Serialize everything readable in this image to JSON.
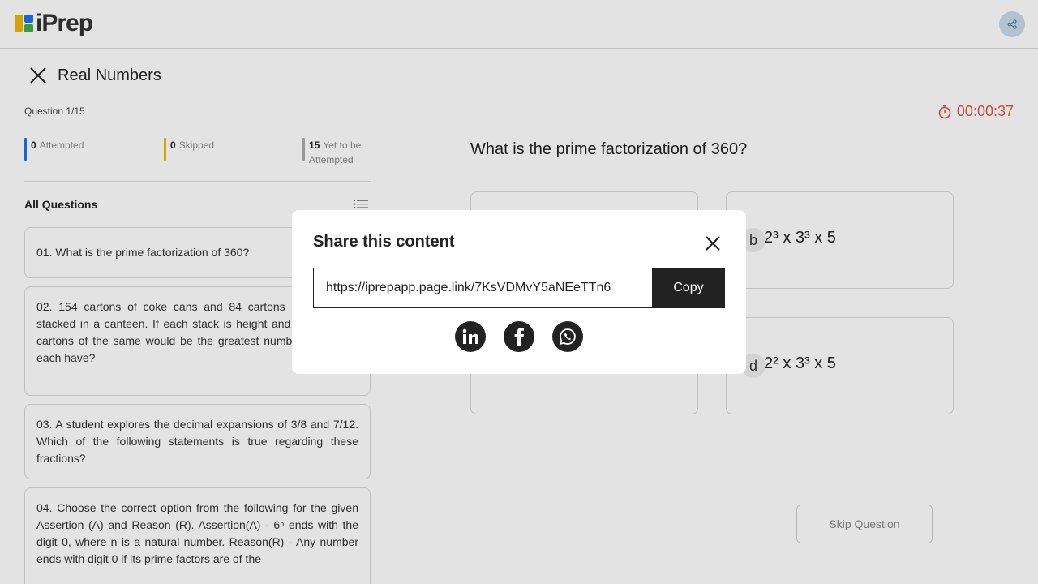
{
  "header": {
    "logo_text": "iPrep"
  },
  "quiz": {
    "title": "Real Numbers",
    "counter": "Question 1/15",
    "timer": "00:00:37",
    "stats": [
      {
        "count": "0",
        "label": "Attempted",
        "color": "#1e73e8"
      },
      {
        "count": "0",
        "label": "Skipped",
        "color": "#f2b705"
      },
      {
        "count": "15",
        "label": "Yet to be Attempted",
        "color": "#aaaaaa"
      }
    ],
    "all_questions_label": "All Questions",
    "questions": [
      "01. What is the prime factorization of 360?",
      "02. 154 cartons of coke cans and 84 cartons of are to be stacked in a canteen. If each stack is height and is to contain cartons of the same would be the greatest number of cartons each have?",
      "03. A student explores the decimal expansions of 3/8 and 7/12. Which of the following statements is true regarding these fractions?",
      "04. Choose the correct option from the following for the given Assertion (A) and Reason (R). Assertion(A) - 6ⁿ ends with the digit 0, where n is a natural number. Reason(R) - Any number ends with digit 0 if its prime factors are of the"
    ]
  },
  "main": {
    "question": "What is the prime factorization of 360?",
    "options": [
      {
        "letter": "b",
        "text": "2³ x 3³ x 5"
      },
      {
        "letter": "d",
        "text": "2² x 3³ x 5"
      }
    ],
    "skip_label": "Skip Question"
  },
  "modal": {
    "title": "Share this content",
    "link": "https://iprepapp.page.link/7KsVDMvY5aNEeTTn6",
    "copy_label": "Copy",
    "social_icons": [
      "linkedin-icon",
      "facebook-icon",
      "whatsapp-icon"
    ]
  }
}
